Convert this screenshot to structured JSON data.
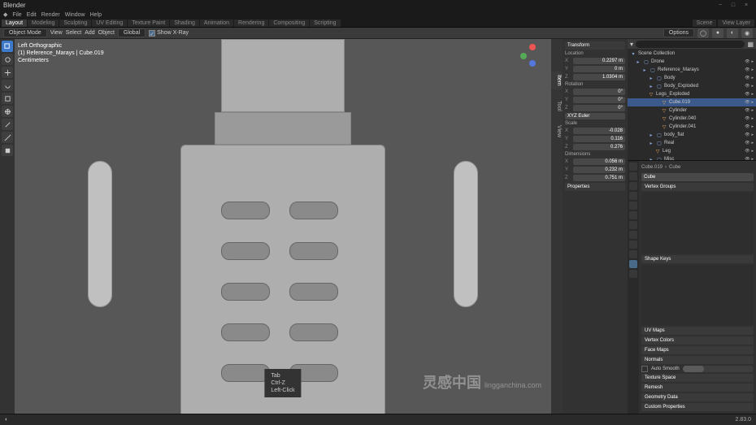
{
  "app": {
    "title": "Blender"
  },
  "menubar": {
    "items": [
      "File",
      "Edit",
      "Render",
      "Window",
      "Help"
    ]
  },
  "workspaces": {
    "active": "Layout",
    "items": [
      "Layout",
      "Modeling",
      "Sculpting",
      "UV Editing",
      "Texture Paint",
      "Shading",
      "Animation",
      "Rendering",
      "Compositing",
      "Scripting"
    ]
  },
  "scene_selector": {
    "scene": "Scene",
    "layer": "View Layer"
  },
  "mode_header": {
    "mode": "Object Mode",
    "view_menu": "View",
    "select_menu": "Select",
    "add_menu": "Add",
    "object_menu": "Object",
    "global": "Global",
    "options": "Options",
    "show_xray": "Show X-Ray"
  },
  "overlay": {
    "view": "Left Orthographic",
    "context": "(1) Reference_Marays | Cube.019",
    "unit": "Centimeters"
  },
  "npanel": {
    "transform": "Transform",
    "location": "Location",
    "rotation": "Rotation",
    "scale": "Scale",
    "dimensions": "Dimensions",
    "loc": {
      "x": "0.2297 m",
      "y": "0 m",
      "z": "1.0304 m"
    },
    "rot": {
      "x": "0°",
      "y": "0°",
      "z": "0°"
    },
    "rotmode": "XYZ Euler",
    "scl": {
      "x": "-0.028",
      "y": "0.116",
      "z": "0.276"
    },
    "dim": {
      "x": "0.056 m",
      "y": "0.232 m",
      "z": "0.751 m"
    },
    "properties": "Properties"
  },
  "outliner": {
    "header": "Scene Collection",
    "items": [
      {
        "n": "Drone",
        "t": "c",
        "i": 0
      },
      {
        "n": "Reference_Marays",
        "t": "c",
        "i": 1
      },
      {
        "n": "Body",
        "t": "c",
        "i": 2
      },
      {
        "n": "Body_Exploded",
        "t": "c",
        "i": 2
      },
      {
        "n": "Legs_Exploded",
        "t": "m",
        "i": 2
      },
      {
        "n": "Cube.019",
        "t": "m",
        "i": 4,
        "sel": true
      },
      {
        "n": "Cylinder",
        "t": "m",
        "i": 4
      },
      {
        "n": "Cylinder.040",
        "t": "m",
        "i": 4
      },
      {
        "n": "Cylinder.041",
        "t": "m",
        "i": 4
      },
      {
        "n": "body_flat",
        "t": "c",
        "i": 2
      },
      {
        "n": "Real",
        "t": "c",
        "i": 2
      },
      {
        "n": "Leg",
        "t": "m",
        "i": 3
      },
      {
        "n": "Misc",
        "t": "c",
        "i": 2
      }
    ]
  },
  "properties": {
    "breadcrumb_a": "Cube.019",
    "breadcrumb_b": "Cube",
    "name": "Cube",
    "sections": [
      "Vertex Groups",
      "Shape Keys",
      "UV Maps",
      "Vertex Colors",
      "Face Maps",
      "Normals",
      "Auto Smooth",
      "Texture Space",
      "Remesh",
      "Geometry Data",
      "Custom Properties"
    ]
  },
  "hints": {
    "l1": "Tab",
    "l2": "Ctrl-Z",
    "l3": "Left-Click"
  },
  "statusbar": {
    "stats": "2.83.0"
  },
  "watermark": {
    "main": "灵感中国",
    "sub": "lingganchina.com"
  }
}
